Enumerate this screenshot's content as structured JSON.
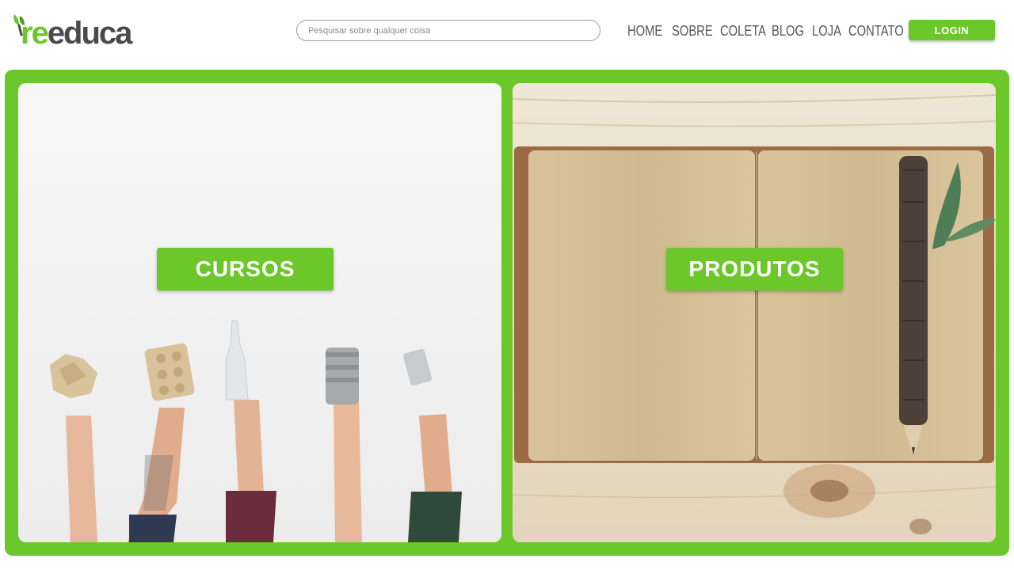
{
  "header": {
    "logo": {
      "prefix": "re",
      "suffix": "educa"
    },
    "search": {
      "placeholder": "Pesquisar sobre qualquer coisa"
    },
    "nav": [
      {
        "label": "HOME"
      },
      {
        "label": "SOBRE"
      },
      {
        "label": "COLETA"
      },
      {
        "label": "BLOG"
      },
      {
        "label": "LOJA"
      },
      {
        "label": "CONTATO"
      }
    ],
    "login_label": "LOGIN"
  },
  "panels": {
    "left": {
      "label": "CURSOS"
    },
    "right": {
      "label": "PRODUTOS"
    }
  },
  "colors": {
    "brand_green": "#6cc72b",
    "text_gray": "#555555"
  }
}
